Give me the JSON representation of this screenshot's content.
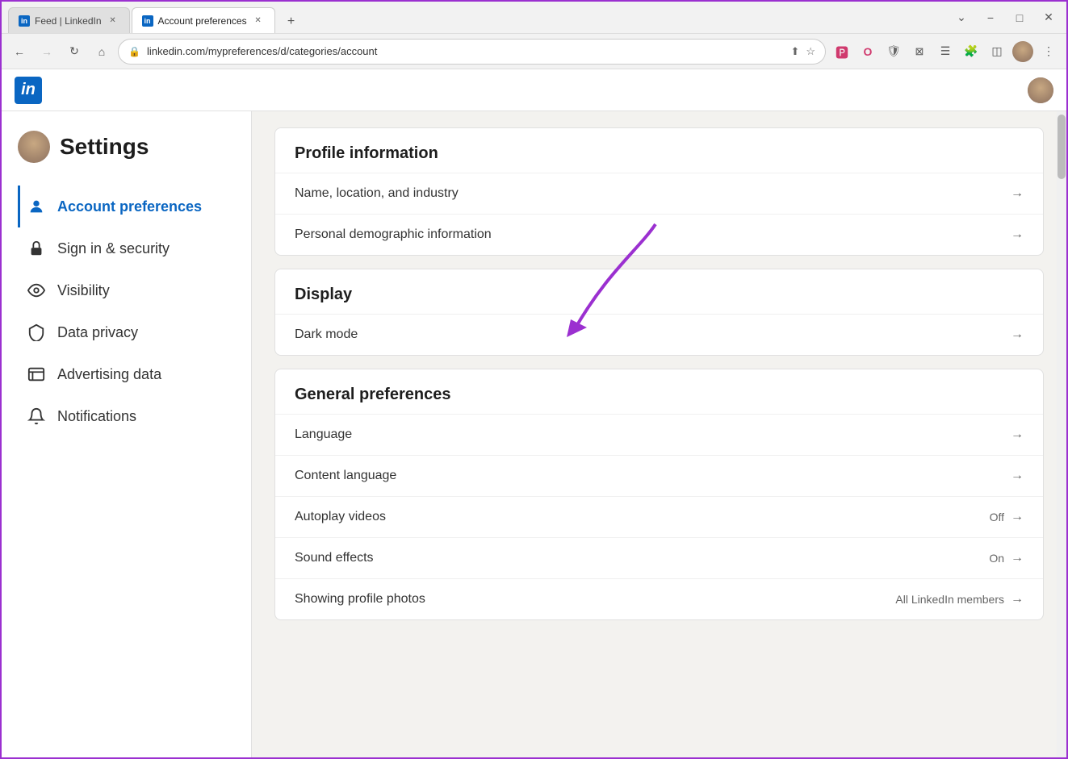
{
  "browser": {
    "tabs": [
      {
        "id": "tab-feed",
        "label": "Feed | LinkedIn",
        "favicon": "in",
        "active": false,
        "closeable": true
      },
      {
        "id": "tab-account",
        "label": "Account preferences",
        "favicon": "in",
        "active": true,
        "closeable": true
      }
    ],
    "new_tab_label": "+",
    "nav": {
      "back_disabled": false,
      "forward_disabled": true,
      "reload_label": "↻",
      "home_label": "⌂"
    },
    "address": "linkedin.com/mypreferences/d/categories/account",
    "window_controls": {
      "minimize": "−",
      "maximize": "□",
      "close": "✕"
    }
  },
  "linkedin": {
    "logo": "in",
    "header_title": "Account preferences"
  },
  "settings": {
    "page_title": "Settings",
    "sidebar": {
      "items": [
        {
          "id": "account-preferences",
          "label": "Account preferences",
          "icon": "person",
          "active": true
        },
        {
          "id": "sign-in-security",
          "label": "Sign in & security",
          "icon": "lock",
          "active": false
        },
        {
          "id": "visibility",
          "label": "Visibility",
          "icon": "eye",
          "active": false
        },
        {
          "id": "data-privacy",
          "label": "Data privacy",
          "icon": "shield",
          "active": false
        },
        {
          "id": "advertising-data",
          "label": "Advertising data",
          "icon": "ad",
          "active": false
        },
        {
          "id": "notifications",
          "label": "Notifications",
          "icon": "bell",
          "active": false
        }
      ]
    },
    "cards": [
      {
        "id": "profile-information",
        "title": "Profile information",
        "items": [
          {
            "id": "name-location",
            "label": "Name, location, and industry",
            "value": "",
            "arrow": "→"
          },
          {
            "id": "personal-demographic",
            "label": "Personal demographic information",
            "value": "",
            "arrow": "→"
          }
        ]
      },
      {
        "id": "display",
        "title": "Display",
        "items": [
          {
            "id": "dark-mode",
            "label": "Dark mode",
            "value": "",
            "arrow": "→"
          }
        ]
      },
      {
        "id": "general-preferences",
        "title": "General preferences",
        "items": [
          {
            "id": "language",
            "label": "Language",
            "value": "",
            "arrow": "→"
          },
          {
            "id": "content-language",
            "label": "Content language",
            "value": "",
            "arrow": "→"
          },
          {
            "id": "autoplay-videos",
            "label": "Autoplay videos",
            "value": "Off",
            "arrow": "→"
          },
          {
            "id": "sound-effects",
            "label": "Sound effects",
            "value": "On",
            "arrow": "→"
          },
          {
            "id": "showing-profile-photos",
            "label": "Showing profile photos",
            "value": "All LinkedIn members",
            "arrow": "→"
          }
        ]
      }
    ]
  }
}
